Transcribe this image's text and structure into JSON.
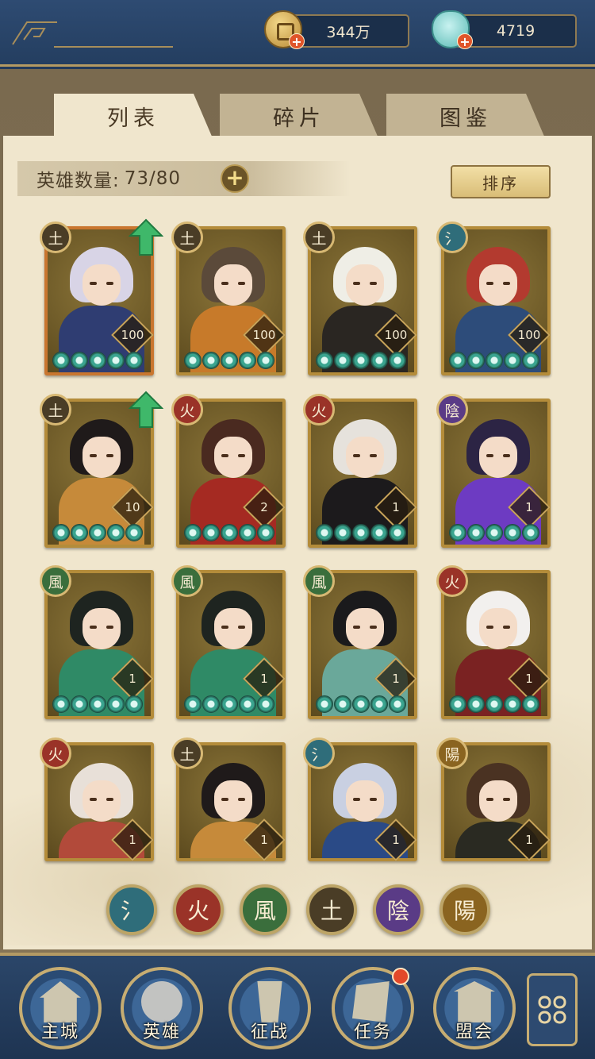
{
  "currency": {
    "coins": "344万",
    "gems": "4719",
    "coin_icon": "copper-coin-icon",
    "gem_icon": "jade-gem-icon"
  },
  "tabs": [
    {
      "label": "列表",
      "active": true
    },
    {
      "label": "碎片",
      "active": false
    },
    {
      "label": "图鉴",
      "active": false
    }
  ],
  "hero_count": {
    "label": "英雄数量:",
    "value": "73/80"
  },
  "sort_label": "排序",
  "elements": {
    "water": {
      "glyph": "氵",
      "color": "#2f6d7a"
    },
    "fire": {
      "glyph": "火",
      "color": "#9a3328"
    },
    "wind": {
      "glyph": "風",
      "color": "#3a6e3c"
    },
    "earth": {
      "glyph": "土",
      "color": "#4a3d26"
    },
    "yin": {
      "glyph": "陰",
      "color": "#5a3b86"
    },
    "yang": {
      "glyph": "陽",
      "color": "#8a6420"
    }
  },
  "heroes": [
    {
      "element": "土",
      "level": "100",
      "stars": 5,
      "upgrade": true,
      "palette": [
        "#d8d4e6",
        "#2f3d72"
      ]
    },
    {
      "element": "土",
      "level": "100",
      "stars": 5,
      "upgrade": false,
      "palette": [
        "#5b4a3a",
        "#c77a2a"
      ]
    },
    {
      "element": "土",
      "level": "100",
      "stars": 5,
      "upgrade": false,
      "palette": [
        "#efeee6",
        "#2a2622"
      ]
    },
    {
      "element": "氵",
      "level": "100",
      "stars": 5,
      "upgrade": false,
      "palette": [
        "#b33a2f",
        "#2d4c7a"
      ]
    },
    {
      "element": "土",
      "level": "10",
      "stars": 5,
      "upgrade": true,
      "palette": [
        "#1f1a1a",
        "#c68a3a"
      ]
    },
    {
      "element": "火",
      "level": "2",
      "stars": 5,
      "upgrade": false,
      "palette": [
        "#4a2a20",
        "#a52a22"
      ]
    },
    {
      "element": "火",
      "level": "1",
      "stars": 5,
      "upgrade": false,
      "palette": [
        "#e6e2dc",
        "#1c1a1c"
      ]
    },
    {
      "element": "陰",
      "level": "1",
      "stars": 5,
      "upgrade": false,
      "palette": [
        "#2c2444",
        "#6d3bc2"
      ]
    },
    {
      "element": "風",
      "level": "1",
      "stars": 5,
      "upgrade": false,
      "palette": [
        "#1e2420",
        "#2f8a66"
      ]
    },
    {
      "element": "風",
      "level": "1",
      "stars": 5,
      "upgrade": false,
      "palette": [
        "#1e2420",
        "#2f8a66"
      ]
    },
    {
      "element": "風",
      "level": "1",
      "stars": 5,
      "upgrade": false,
      "palette": [
        "#1a1a1c",
        "#6aa89a"
      ]
    },
    {
      "element": "火",
      "level": "1",
      "stars": 5,
      "upgrade": false,
      "palette": [
        "#f2f0ee",
        "#7a2222"
      ]
    },
    {
      "element": "火",
      "level": "1",
      "stars": 0,
      "upgrade": false,
      "palette": [
        "#e8e0d8",
        "#b24a3a"
      ]
    },
    {
      "element": "土",
      "level": "1",
      "stars": 0,
      "upgrade": false,
      "palette": [
        "#1f1a1a",
        "#c68a3a"
      ]
    },
    {
      "element": "氵",
      "level": "1",
      "stars": 0,
      "upgrade": false,
      "palette": [
        "#c9d0e2",
        "#2a4a86"
      ]
    },
    {
      "element": "陽",
      "level": "1",
      "stars": 0,
      "upgrade": false,
      "palette": [
        "#4a3222",
        "#2a2a22"
      ]
    }
  ],
  "filters": [
    "氵",
    "火",
    "風",
    "土",
    "陰",
    "陽"
  ],
  "nav": [
    {
      "label": "主城",
      "icon": "palace-icon"
    },
    {
      "label": "英雄",
      "icon": "hero-portrait-icon"
    },
    {
      "label": "征战",
      "icon": "battle-scroll-icon"
    },
    {
      "label": "任务",
      "icon": "quest-scroll-icon",
      "badge": true
    },
    {
      "label": "盟会",
      "icon": "guild-hall-icon"
    }
  ],
  "menu_icon": "flower-menu-icon"
}
